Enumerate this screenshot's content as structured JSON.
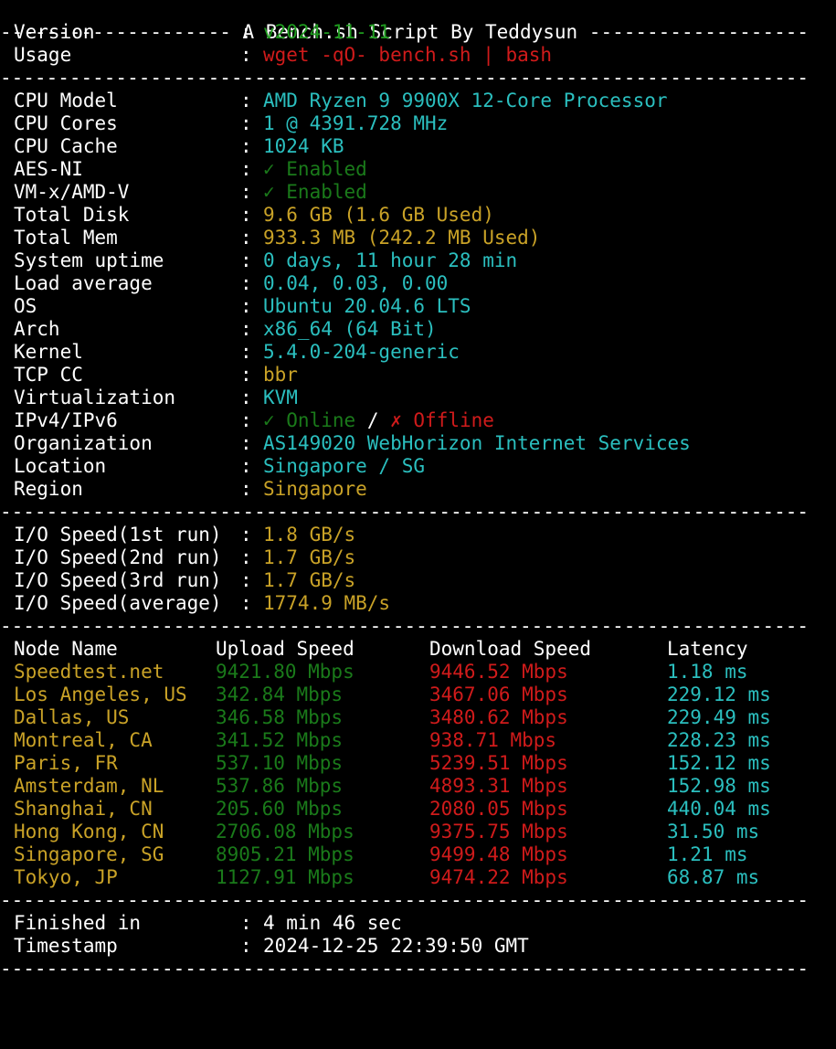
{
  "colors": {
    "background": "#000000",
    "green": "#1f9c1f",
    "red": "#d01b1b",
    "cyan": "#2bbfbf",
    "yellow": "#c9a227",
    "white": "#ffffff"
  },
  "header": {
    "title": "-------------------- A Bench.sh Script By Teddysun -------------------"
  },
  "separator": "----------------------------------------------------------------------",
  "info": {
    "version_label": "Version",
    "version_value": "v2024-11-11",
    "usage_label": "Usage",
    "usage_value": "wget -qO- bench.sh | bash"
  },
  "colon": ":",
  "system": [
    {
      "label": "CPU Model",
      "value": "AMD Ryzen 9 9900X 12-Core Processor",
      "color": "cyan"
    },
    {
      "label": "CPU Cores",
      "value": "1 @ 4391.728 MHz",
      "color": "cyan"
    },
    {
      "label": "CPU Cache",
      "value": "1024 KB",
      "color": "cyan"
    },
    {
      "label": "AES-NI",
      "value": "✓ Enabled",
      "color": "dimgreen"
    },
    {
      "label": "VM-x/AMD-V",
      "value": "✓ Enabled",
      "color": "dimgreen"
    },
    {
      "label": "Total Disk",
      "value": "9.6 GB (1.6 GB Used)",
      "color": "yellow"
    },
    {
      "label": "Total Mem",
      "value": "933.3 MB (242.2 MB Used)",
      "color": "yellow"
    },
    {
      "label": "System uptime",
      "value": "0 days, 11 hour 28 min",
      "color": "cyan"
    },
    {
      "label": "Load average",
      "value": "0.04, 0.03, 0.00",
      "color": "cyan"
    },
    {
      "label": "OS",
      "value": "Ubuntu 20.04.6 LTS",
      "color": "cyan"
    },
    {
      "label": "Arch",
      "value": "x86_64 (64 Bit)",
      "color": "cyan"
    },
    {
      "label": "Kernel",
      "value": "5.4.0-204-generic",
      "color": "cyan"
    },
    {
      "label": "TCP CC",
      "value": "bbr",
      "color": "yellow"
    },
    {
      "label": "Virtualization",
      "value": "KVM",
      "color": "cyan"
    }
  ],
  "ip": {
    "label": "IPv4/IPv6",
    "online": "✓ Online",
    "slash": "/",
    "offline": "✗ Offline"
  },
  "system2": [
    {
      "label": "Organization",
      "value": "AS149020 WebHorizon Internet Services",
      "color": "cyan"
    },
    {
      "label": "Location",
      "value": "Singapore / SG",
      "color": "cyan"
    },
    {
      "label": "Region",
      "value": "Singapore",
      "color": "yellow"
    }
  ],
  "io": [
    {
      "label": "I/O Speed(1st run)",
      "value": "1.8 GB/s"
    },
    {
      "label": "I/O Speed(2nd run)",
      "value": "1.7 GB/s"
    },
    {
      "label": "I/O Speed(3rd run)",
      "value": "1.7 GB/s"
    },
    {
      "label": "I/O Speed(average)",
      "value": "1774.9 MB/s"
    }
  ],
  "speed_headers": {
    "node": "Node Name",
    "upload": "Upload Speed",
    "download": "Download Speed",
    "latency": "Latency"
  },
  "speed_rows": [
    {
      "node": "Speedtest.net",
      "upload": "9421.80 Mbps",
      "download": "9446.52 Mbps",
      "latency": "1.18 ms"
    },
    {
      "node": "Los Angeles, US",
      "upload": "342.84 Mbps",
      "download": "3467.06 Mbps",
      "latency": "229.12 ms"
    },
    {
      "node": "Dallas, US",
      "upload": "346.58 Mbps",
      "download": "3480.62 Mbps",
      "latency": "229.49 ms"
    },
    {
      "node": "Montreal, CA",
      "upload": "341.52 Mbps",
      "download": "938.71 Mbps",
      "latency": "228.23 ms"
    },
    {
      "node": "Paris, FR",
      "upload": "537.10 Mbps",
      "download": "5239.51 Mbps",
      "latency": "152.12 ms"
    },
    {
      "node": "Amsterdam, NL",
      "upload": "537.86 Mbps",
      "download": "4893.31 Mbps",
      "latency": "152.98 ms"
    },
    {
      "node": "Shanghai, CN",
      "upload": "205.60 Mbps",
      "download": "2080.05 Mbps",
      "latency": "440.04 ms"
    },
    {
      "node": "Hong Kong, CN",
      "upload": "2706.08 Mbps",
      "download": "9375.75 Mbps",
      "latency": "31.50 ms"
    },
    {
      "node": "Singapore, SG",
      "upload": "8905.21 Mbps",
      "download": "9499.48 Mbps",
      "latency": "1.21 ms"
    },
    {
      "node": "Tokyo, JP",
      "upload": "1127.91 Mbps",
      "download": "9474.22 Mbps",
      "latency": "68.87 ms"
    }
  ],
  "footer": {
    "finished_label": "Finished in",
    "finished_value": "4 min 46 sec",
    "timestamp_label": "Timestamp",
    "timestamp_value": "2024-12-25 22:39:50 GMT"
  }
}
